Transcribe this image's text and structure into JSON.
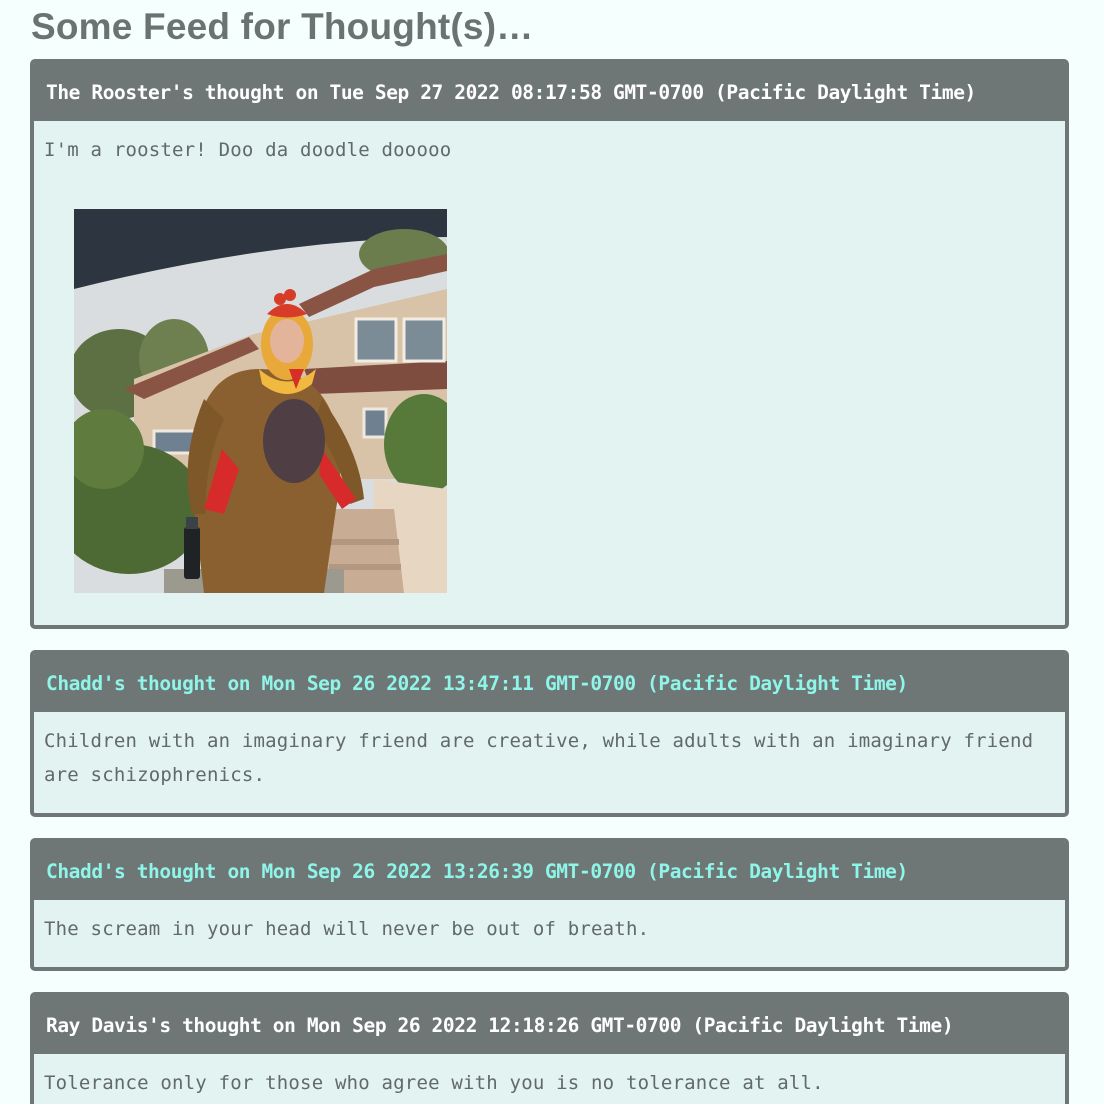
{
  "page": {
    "title": "Some Feed for Thought(s)…"
  },
  "posts": [
    {
      "header": "The Rooster's thought on Tue Sep 27 2022 08:17:58 GMT-0700 (Pacific Daylight Time)",
      "body": "I'm a rooster! Doo da doodle dooooo",
      "image_alt": "Person in a rooster costume standing in front of a house"
    },
    {
      "header": "Chadd's thought on Mon Sep 26 2022 13:47:11 GMT-0700 (Pacific Daylight Time)",
      "body": "Children with an imaginary friend are creative, while adults with an imaginary friend are schizophrenics."
    },
    {
      "header": "Chadd's thought on Mon Sep 26 2022 13:26:39 GMT-0700 (Pacific Daylight Time)",
      "body": "The scream in your head will never be out of breath."
    },
    {
      "header": "Ray Davis's thought on Mon Sep 26 2022 12:18:26 GMT-0700 (Pacific Daylight Time)",
      "body": "Tolerance only for those who agree with you is no tolerance at all."
    }
  ],
  "colors": {
    "background": "#f5fffd",
    "card_border": "#6e7676",
    "card_body": "#e2f3f2",
    "header_text_white": "#ffffff",
    "header_text_aqua": "#8ff5e8",
    "body_text": "#616969"
  }
}
